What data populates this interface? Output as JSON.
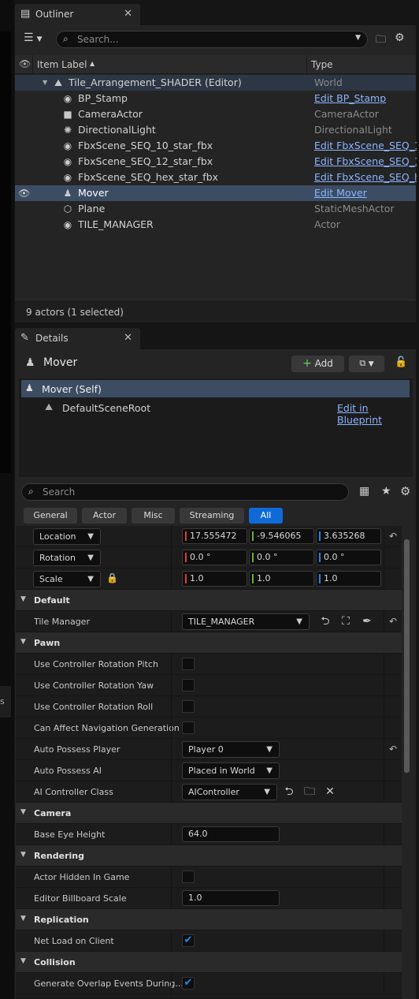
{
  "outliner": {
    "tab_label": "Outliner",
    "search_placeholder": "Search...",
    "col_label": "Item Label",
    "col_type": "Type",
    "status": "9 actors (1 selected)",
    "rows": [
      {
        "label": "Tile_Arrangement_SHADER (Editor)",
        "type": "World",
        "type_link": false,
        "icon": "world-icon"
      },
      {
        "label": "BP_Stamp",
        "type": "Edit BP_Stamp",
        "type_link": true,
        "icon": "actor-icon"
      },
      {
        "label": "CameraActor",
        "type": "CameraActor",
        "type_link": false,
        "icon": "camera-icon"
      },
      {
        "label": "DirectionalLight",
        "type": "DirectionalLight",
        "type_link": false,
        "icon": "light-icon"
      },
      {
        "label": "FbxScene_SEQ_10_star_fbx",
        "type": "Edit FbxScene_SEQ_10",
        "type_link": true,
        "icon": "actor-icon"
      },
      {
        "label": "FbxScene_SEQ_12_star_fbx",
        "type": "Edit FbxScene_SEQ_12",
        "type_link": true,
        "icon": "actor-icon"
      },
      {
        "label": "FbxScene_SEQ_hex_star_fbx",
        "type": "Edit FbxScene_SEQ_he",
        "type_link": true,
        "icon": "actor-icon"
      },
      {
        "label": "Mover",
        "type": "Edit Mover",
        "type_link": true,
        "icon": "pawn-icon"
      },
      {
        "label": "Plane",
        "type": "StaticMeshActor",
        "type_link": false,
        "icon": "mesh-icon"
      },
      {
        "label": "TILE_MANAGER",
        "type": "Actor",
        "type_link": false,
        "icon": "actor-icon"
      }
    ]
  },
  "details": {
    "tab_label": "Details",
    "actor_name": "Mover",
    "add_label": "Add",
    "self_label": "Mover (Self)",
    "component": "DefaultSceneRoot",
    "edit_blueprint": "Edit in Blueprint",
    "search_placeholder": "Search",
    "filters": [
      "General",
      "Actor",
      "Misc",
      "Streaming",
      "All"
    ],
    "transform": {
      "location_label": "Location",
      "location": [
        "17.555472",
        "-9.546065",
        "3.635268"
      ],
      "rotation_label": "Rotation",
      "rotation": [
        "0.0 °",
        "0.0 °",
        "0.0 °"
      ],
      "scale_label": "Scale",
      "scale": [
        "1.0",
        "1.0",
        "1.0"
      ]
    },
    "default": {
      "title": "Default",
      "tile_manager_label": "Tile Manager",
      "tile_manager_value": "TILE_MANAGER"
    },
    "pawn": {
      "title": "Pawn",
      "pitch": "Use Controller Rotation Pitch",
      "yaw": "Use Controller Rotation Yaw",
      "roll": "Use Controller Rotation Roll",
      "nav": "Can Affect Navigation Generation",
      "auto_player_label": "Auto Possess Player",
      "auto_player_value": "Player 0",
      "auto_ai_label": "Auto Possess AI",
      "auto_ai_value": "Placed in World",
      "ai_class_label": "AI Controller Class",
      "ai_class_value": "AIController"
    },
    "camera": {
      "title": "Camera",
      "eye_label": "Base Eye Height",
      "eye_value": "64.0"
    },
    "rendering": {
      "title": "Rendering",
      "hidden_label": "Actor Hidden In Game",
      "billboard_label": "Editor Billboard Scale",
      "billboard_value": "1.0"
    },
    "replication": {
      "title": "Replication",
      "net_label": "Net Load on Client"
    },
    "collision": {
      "title": "Collision",
      "overlap_label": "Generate Overlap Events During..."
    }
  },
  "colors": {
    "accent": "#0f6ad8",
    "link": "#8ab4ff",
    "selection": "#3c4d63",
    "x_axis": "#e03a3a",
    "y_axis": "#5fb530",
    "z_axis": "#2c7de0"
  }
}
